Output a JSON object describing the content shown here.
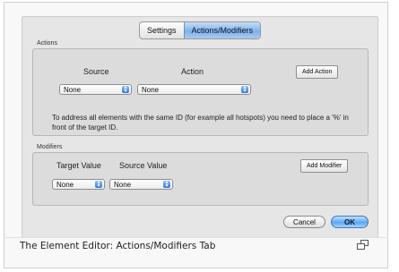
{
  "tabs": [
    {
      "label": "Settings",
      "selected": false
    },
    {
      "label": "Actions/Modifiers",
      "selected": true
    }
  ],
  "actions": {
    "group_label": "Actions",
    "source_header": "Source",
    "action_header": "Action",
    "add_button": "Add Action",
    "source_select": "None",
    "action_select": "None",
    "note": "To address all elements with the same ID (for example all hotspots) you need to place a '%' in front of the target ID."
  },
  "modifiers": {
    "group_label": "Modifiers",
    "target_header": "Target Value",
    "source_header": "Source Value",
    "add_button": "Add Modifier",
    "target_select": "None",
    "source_select": "None"
  },
  "footer": {
    "cancel_label": "Cancel",
    "ok_label": "OK"
  },
  "caption": "The Element Editor: Actions/Modifiers Tab",
  "colors": {
    "dialog_bg": "#e6e6e6",
    "accent_blue": "#5aa7f1"
  },
  "icons": {
    "select_arrow": "up-down-chevron-icon",
    "expand": "expand-icon"
  }
}
